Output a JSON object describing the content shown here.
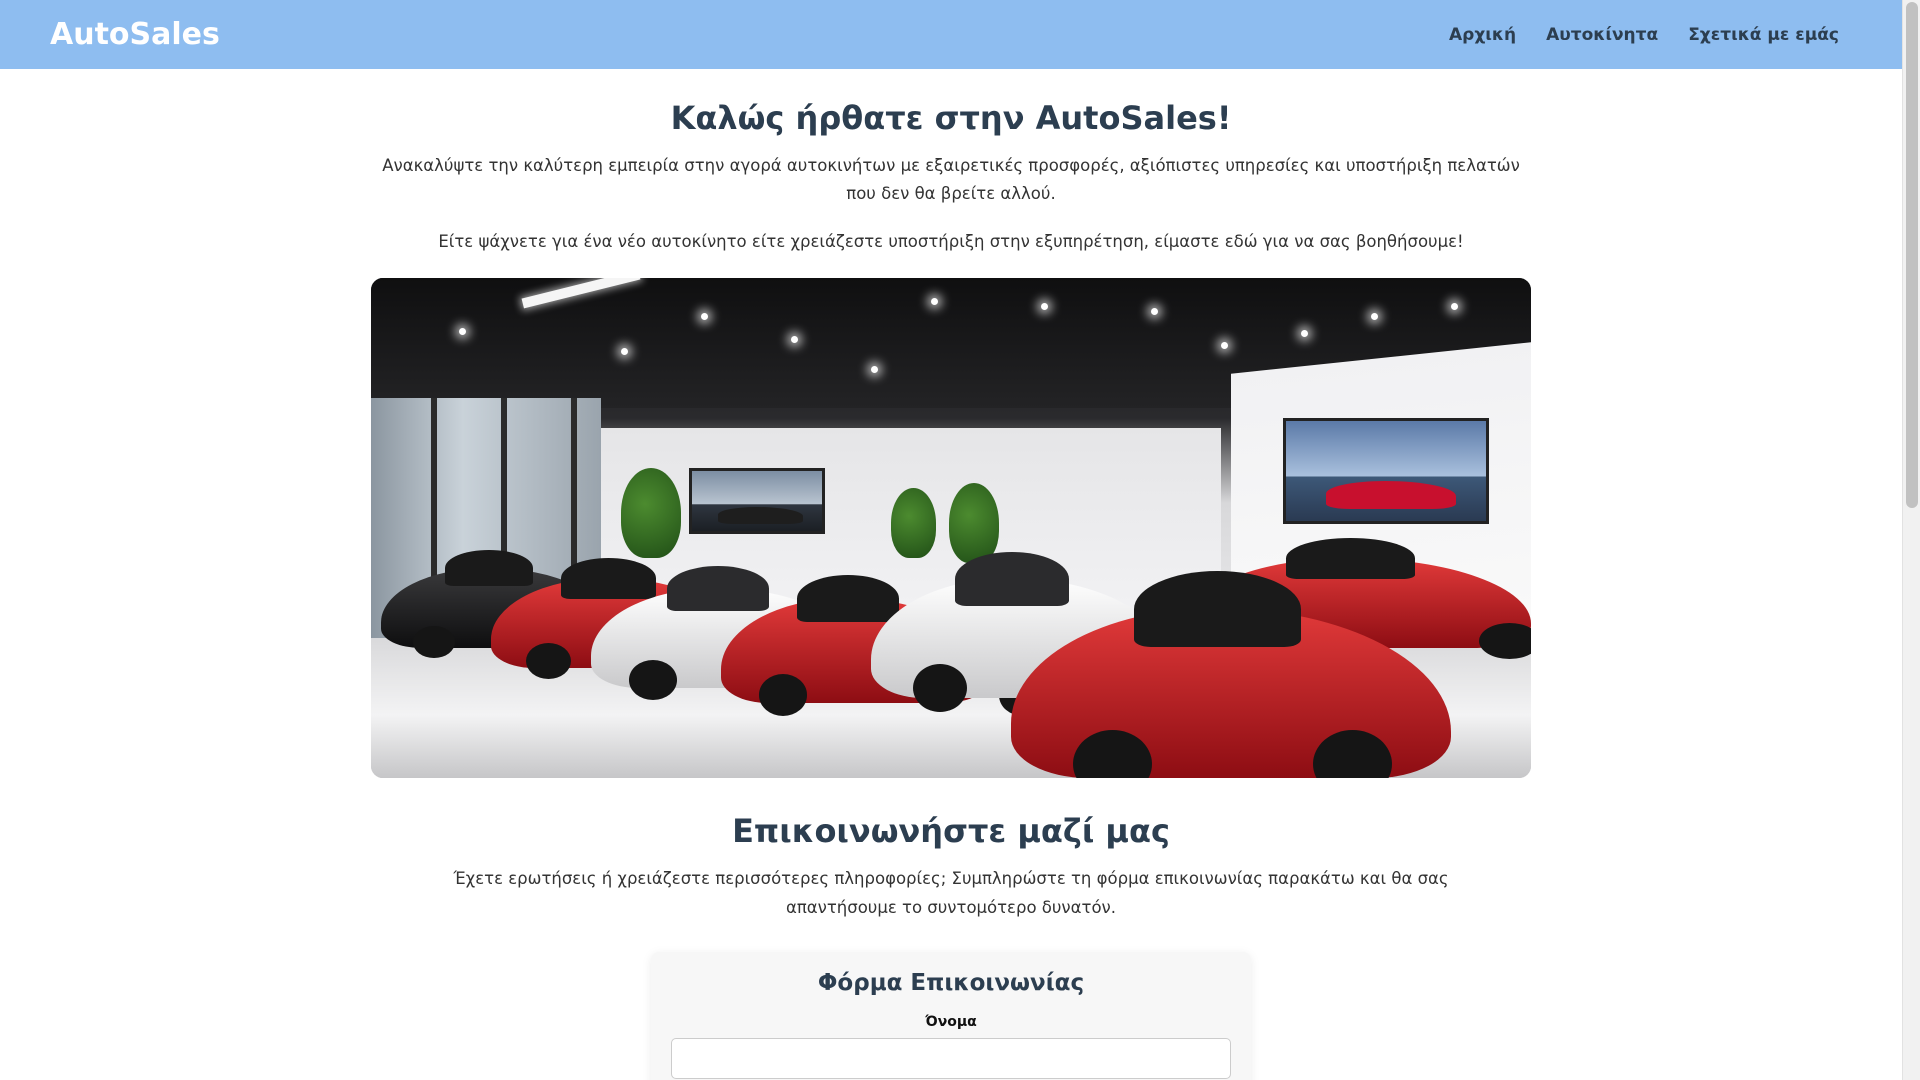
{
  "header": {
    "brand": "AutoSales",
    "nav": [
      {
        "label": "Αρχική"
      },
      {
        "label": "Αυτοκίνητα"
      },
      {
        "label": "Σχετικά με εμάς"
      }
    ]
  },
  "hero": {
    "title": "Καλώς ήρθατε στην AutoSales!",
    "intro": "Ανακαλύψτε την καλύτερη εμπειρία στην αγορά αυτοκινήτων με εξαιρετικές προσφορές, αξιόπιστες υπηρεσίες και υποστήριξη πελατών που δεν θα βρείτε αλλού.",
    "intro2": "Είτε ψάχνετε για ένα νέο αυτοκίνητο είτε χρειάζεστε υποστήριξη στην εξυπηρέτηση, είμαστε εδώ για να σας βοηθήσουμε!"
  },
  "contact": {
    "title": "Επικοινωνήστε μαζί μας",
    "text": "Έχετε ερωτήσεις ή χρειάζεστε περισσότερες πληροφορίες; Συμπληρώστε τη φόρμα επικοινωνίας παρακάτω και θα σας απαντήσουμε το συντομότερο δυνατόν.",
    "form": {
      "title": "Φόρμα Επικοινωνίας",
      "name_label": "Όνομα",
      "name_value": ""
    }
  },
  "colors": {
    "header_bg": "#8ebdf0",
    "brand_text": "#ffffff",
    "heading_text": "#2c3e50"
  },
  "icons": {
    "showroom_image": "car-showroom-image"
  }
}
